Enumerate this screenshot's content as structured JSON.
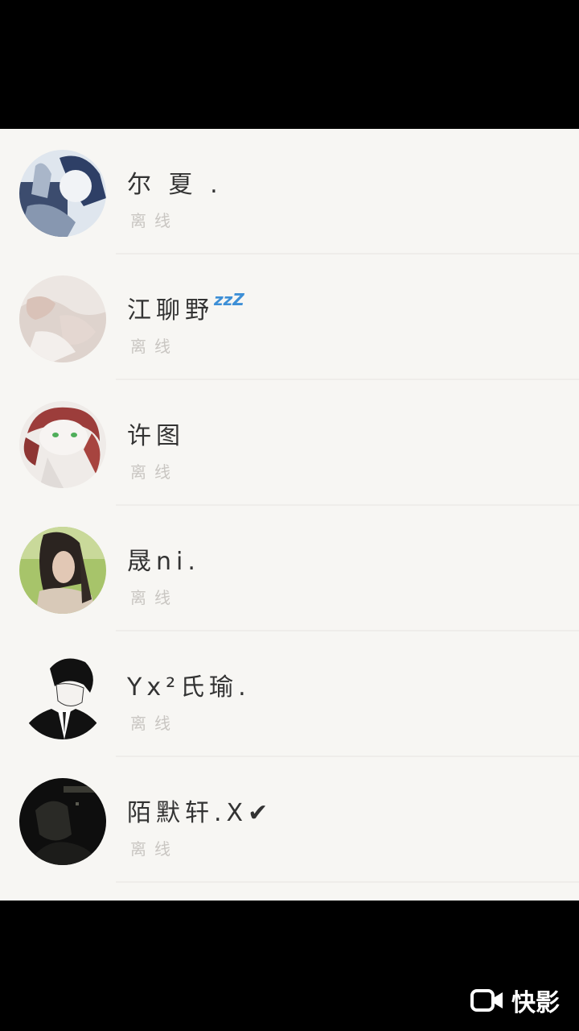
{
  "contacts": [
    {
      "name": "尔 夏 .",
      "status": "离线",
      "badge": "",
      "avatar": "anime-boy-blue-avatar",
      "avatar_colors": [
        "#2e3f66",
        "#a9b6c9",
        "#e7ecf1"
      ]
    },
    {
      "name": "江聊野",
      "status": "离线",
      "badge": "zzZ",
      "avatar": "pale-hands-avatar",
      "avatar_colors": [
        "#d9cdc6",
        "#ece6e2",
        "#b7a7a0"
      ]
    },
    {
      "name": "许图",
      "status": "离线",
      "badge": "",
      "avatar": "red-hair-anime-avatar",
      "avatar_colors": [
        "#9c3d3b",
        "#f2eeec",
        "#4fae5a"
      ]
    },
    {
      "name": "晟ni.",
      "status": "离线",
      "badge": "",
      "avatar": "girl-outdoor-avatar",
      "avatar_colors": [
        "#8fb04f",
        "#2b2420",
        "#d8c9b8"
      ]
    },
    {
      "name": "Yx²氏瑜.",
      "status": "离线",
      "badge": "",
      "avatar": "suit-boy-sketch-avatar",
      "avatar_colors": [
        "#ffffff",
        "#111111",
        "#333333"
      ]
    },
    {
      "name": "陌默轩.X✔",
      "status": "离线",
      "badge": "",
      "avatar": "dark-night-avatar",
      "avatar_colors": [
        "#0e0e0e",
        "#2a2a26",
        "#5a5a50"
      ]
    }
  ],
  "watermark": {
    "brand": "快影",
    "icon": "video-camera-icon"
  },
  "colors": {
    "panel": "#f7f6f3",
    "letterbox": "#000000",
    "name_text": "#333333",
    "status_text": "#c9c6c2",
    "badge": "#3d8fd6"
  }
}
